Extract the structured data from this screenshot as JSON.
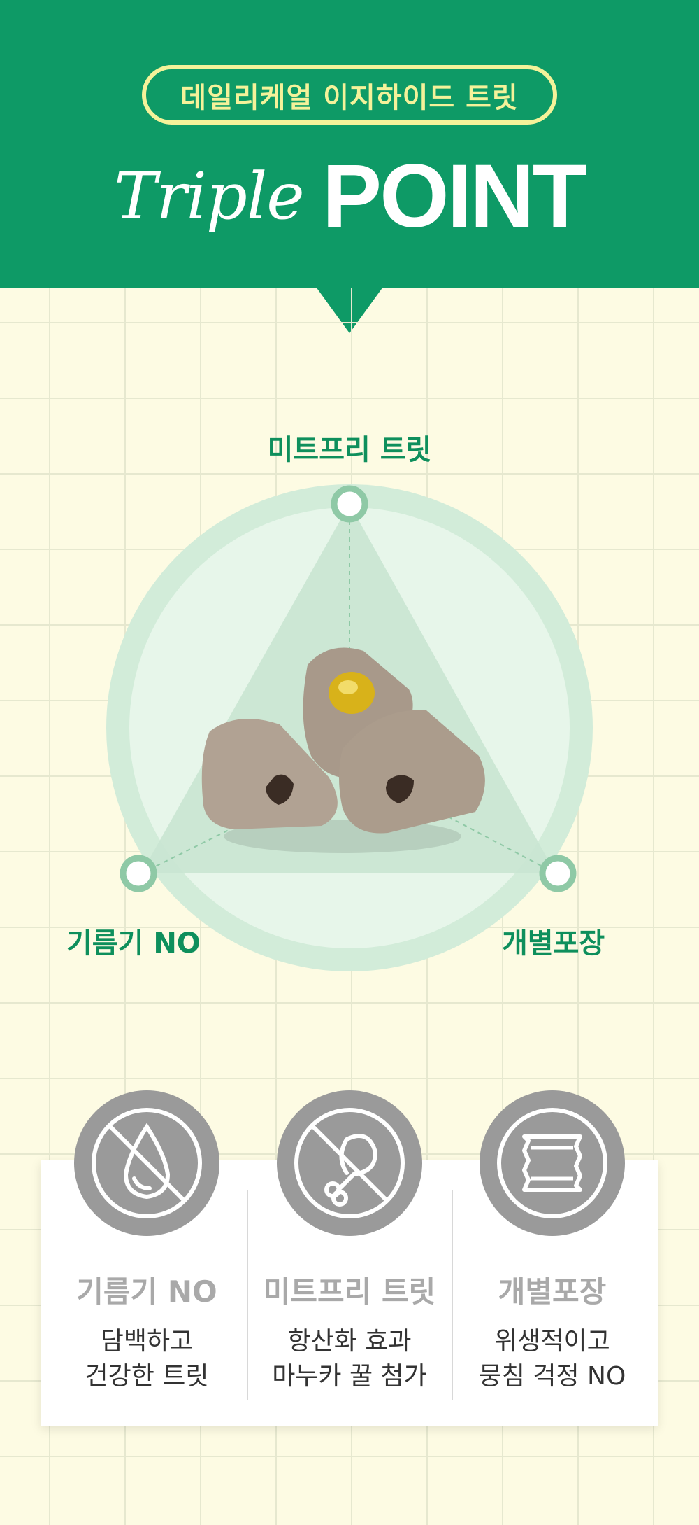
{
  "header": {
    "product_name": "데일리케얼 이지하이드 트릿",
    "title_script": "Triple",
    "title_bold": "POINT",
    "bg_color": "#0e9a66",
    "pill_color": "#f4f29a"
  },
  "diagram": {
    "labels": {
      "top": "미트프리 트릿",
      "left": "기름기 NO",
      "right": "개별포장"
    },
    "accent_color": "#0e8f5c"
  },
  "features": [
    {
      "icon": "no-oil-drop-icon",
      "title": "기름기 NO",
      "desc": [
        "담백하고",
        "건강한 트릿"
      ]
    },
    {
      "icon": "no-meat-drumstick-icon",
      "title": "미트프리 트릿",
      "desc": [
        "항산화 효과",
        "마누카 꿀 첨가"
      ]
    },
    {
      "icon": "individual-pack-icon",
      "title": "개별포장",
      "desc": [
        "위생적이고",
        "뭉침 걱정 NO"
      ]
    }
  ]
}
